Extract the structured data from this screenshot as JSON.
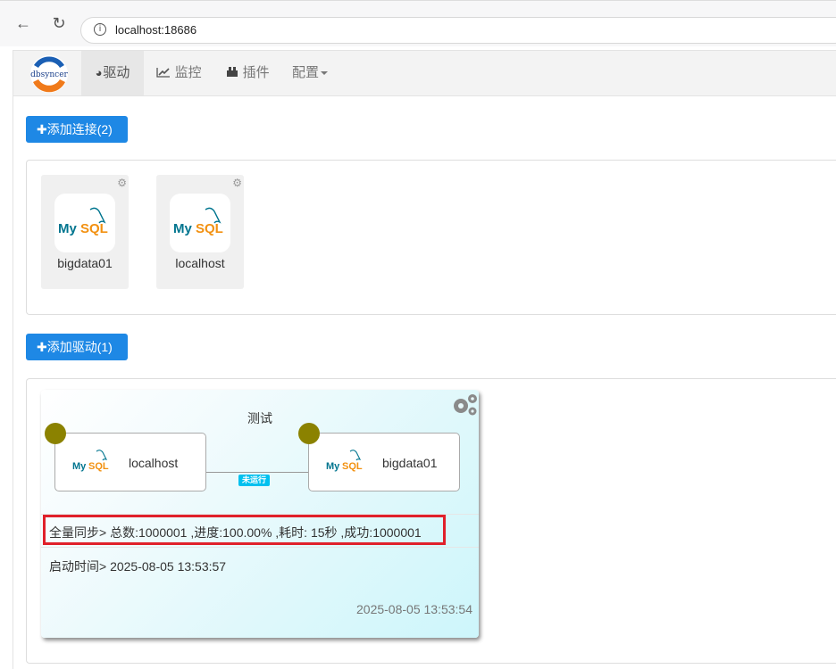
{
  "browser": {
    "url": "localhost:18686"
  },
  "nav": {
    "logo_text": "dbsyncer",
    "items": [
      {
        "label": "驱动",
        "icon": "dashboard-icon",
        "active": true
      },
      {
        "label": "监控",
        "icon": "line-chart-icon"
      },
      {
        "label": "插件",
        "icon": "plugin-icon"
      },
      {
        "label": "配置",
        "icon": "caret-down-icon",
        "dropdown": true
      }
    ]
  },
  "connections": {
    "add_label": "添加连接(2)",
    "items": [
      {
        "name": "bigdata01",
        "type": "MySQL"
      },
      {
        "name": "localhost",
        "type": "MySQL"
      }
    ]
  },
  "drivers": {
    "add_label": "添加驱动(1)",
    "items": [
      {
        "name": "测试",
        "source": {
          "name": "localhost",
          "type": "MySQL"
        },
        "target": {
          "name": "bigdata01",
          "type": "MySQL"
        },
        "status": "未运行",
        "sync_info": "全量同步> 总数:1000001 ,进度:100.00% ,耗时: 15秒 ,成功:1000001",
        "start_time": "启动时间> 2025-08-05 13:53:57",
        "updated": "2025-08-05 13:53:54"
      }
    ]
  },
  "colors": {
    "primary": "#1e88e5",
    "status_badge": "#00c0ef",
    "endpoint_dot": "#8b8200",
    "highlight": "#e0202a"
  }
}
